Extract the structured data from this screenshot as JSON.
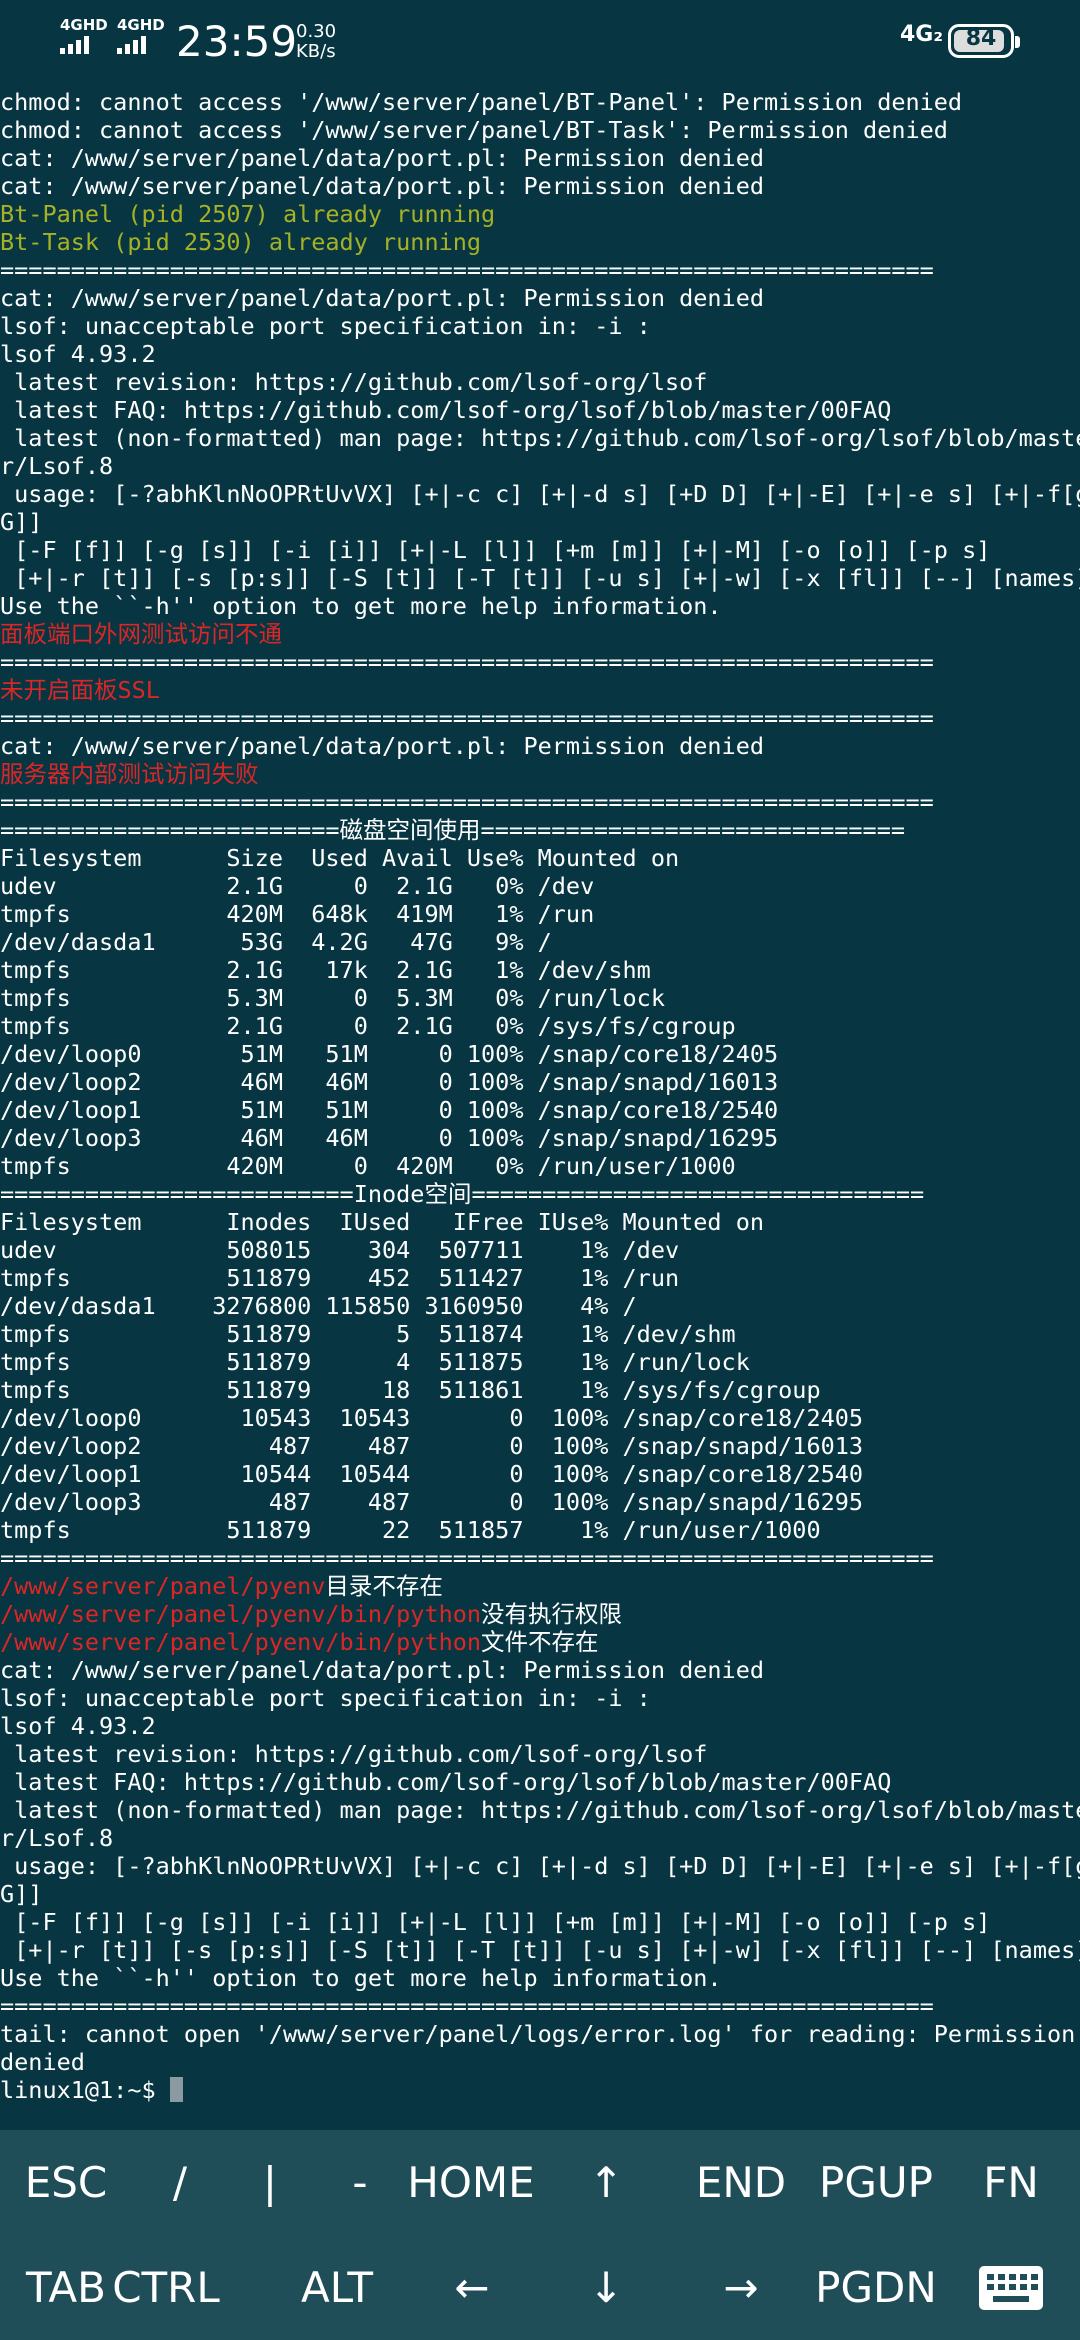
{
  "status_bar": {
    "sim1": "4GHD",
    "sim2": "4GHD",
    "time": "23:59",
    "speed_value": "0.30",
    "speed_unit": "KB/s",
    "network": "4G₂",
    "battery": "84"
  },
  "terminal": {
    "lines": [
      [
        {
          "t": "chmod: cannot access '/www/server/panel/BT-Panel': Permission denied",
          "c": "w"
        }
      ],
      [
        {
          "t": "chmod: cannot access '/www/server/panel/BT-Task': Permission denied",
          "c": "w"
        }
      ],
      [
        {
          "t": "cat: /www/server/panel/data/port.pl: Permission denied",
          "c": "w"
        }
      ],
      [
        {
          "t": "cat: /www/server/panel/data/port.pl: Permission denied",
          "c": "w"
        }
      ],
      [
        {
          "t": "Bt-Panel (pid 2507) already running",
          "c": "g"
        }
      ],
      [
        {
          "t": "Bt-Task (pid 2530) already running",
          "c": "g"
        }
      ],
      [
        {
          "t": "==================================================================",
          "c": "w"
        }
      ],
      [
        {
          "t": "cat: /www/server/panel/data/port.pl: Permission denied",
          "c": "w"
        }
      ],
      [
        {
          "t": "lsof: unacceptable port specification in: -i :",
          "c": "w"
        }
      ],
      [
        {
          "t": "lsof 4.93.2",
          "c": "w"
        }
      ],
      [
        {
          "t": " latest revision: https://github.com/lsof-org/lsof",
          "c": "w"
        }
      ],
      [
        {
          "t": " latest FAQ: https://github.com/lsof-org/lsof/blob/master/00FAQ",
          "c": "w"
        }
      ],
      [
        {
          "t": " latest (non-formatted) man page: https://github.com/lsof-org/lsof/blob/maste",
          "c": "w"
        }
      ],
      [
        {
          "t": "r/Lsof.8",
          "c": "w"
        }
      ],
      [
        {
          "t": " usage: [-?abhKlnNoOPRtUvVX] [+|-c c] [+|-d s] [+D D] [+|-E] [+|-e s] [+|-f[g",
          "c": "w"
        }
      ],
      [
        {
          "t": "G]]",
          "c": "w"
        }
      ],
      [
        {
          "t": " [-F [f]] [-g [s]] [-i [i]] [+|-L [l]] [+m [m]] [+|-M] [-o [o]] [-p s]",
          "c": "w"
        }
      ],
      [
        {
          "t": " [+|-r [t]] [-s [p:s]] [-S [t]] [-T [t]] [-u s] [+|-w] [-x [fl]] [--] [names]",
          "c": "w"
        }
      ],
      [
        {
          "t": "Use the ``-h'' option to get more help information.",
          "c": "w"
        }
      ],
      [
        {
          "t": "面板端口外网测试访问不通",
          "c": "r"
        }
      ],
      [
        {
          "t": "==================================================================",
          "c": "w"
        }
      ],
      [
        {
          "t": "未开启面板SSL",
          "c": "r"
        }
      ],
      [
        {
          "t": "==================================================================",
          "c": "w"
        }
      ],
      [
        {
          "t": "cat: /www/server/panel/data/port.pl: Permission denied",
          "c": "w"
        }
      ],
      [
        {
          "t": "服务器内部测试访问失败",
          "c": "r"
        }
      ],
      [
        {
          "t": "==================================================================",
          "c": "w"
        }
      ],
      [
        {
          "t": "========================磁盘空间使用==============================",
          "c": "w"
        }
      ],
      [
        {
          "t": "Filesystem      Size  Used Avail Use% Mounted on",
          "c": "w"
        }
      ],
      [
        {
          "t": "udev            2.1G     0  2.1G   0% /dev",
          "c": "w"
        }
      ],
      [
        {
          "t": "tmpfs           420M  648k  419M   1% /run",
          "c": "w"
        }
      ],
      [
        {
          "t": "/dev/dasda1      53G  4.2G   47G   9% /",
          "c": "w"
        }
      ],
      [
        {
          "t": "tmpfs           2.1G   17k  2.1G   1% /dev/shm",
          "c": "w"
        }
      ],
      [
        {
          "t": "tmpfs           5.3M     0  5.3M   0% /run/lock",
          "c": "w"
        }
      ],
      [
        {
          "t": "tmpfs           2.1G     0  2.1G   0% /sys/fs/cgroup",
          "c": "w"
        }
      ],
      [
        {
          "t": "/dev/loop0       51M   51M     0 100% /snap/core18/2405",
          "c": "w"
        }
      ],
      [
        {
          "t": "/dev/loop2       46M   46M     0 100% /snap/snapd/16013",
          "c": "w"
        }
      ],
      [
        {
          "t": "/dev/loop1       51M   51M     0 100% /snap/core18/2540",
          "c": "w"
        }
      ],
      [
        {
          "t": "/dev/loop3       46M   46M     0 100% /snap/snapd/16295",
          "c": "w"
        }
      ],
      [
        {
          "t": "tmpfs           420M     0  420M   0% /run/user/1000",
          "c": "w"
        }
      ],
      [
        {
          "t": "=========================Inode空间================================",
          "c": "w"
        }
      ],
      [
        {
          "t": "Filesystem      Inodes  IUsed   IFree IUse% Mounted on",
          "c": "w"
        }
      ],
      [
        {
          "t": "udev            508015    304  507711    1% /dev",
          "c": "w"
        }
      ],
      [
        {
          "t": "tmpfs           511879    452  511427    1% /run",
          "c": "w"
        }
      ],
      [
        {
          "t": "/dev/dasda1    3276800 115850 3160950    4% /",
          "c": "w"
        }
      ],
      [
        {
          "t": "tmpfs           511879      5  511874    1% /dev/shm",
          "c": "w"
        }
      ],
      [
        {
          "t": "tmpfs           511879      4  511875    1% /run/lock",
          "c": "w"
        }
      ],
      [
        {
          "t": "tmpfs           511879     18  511861    1% /sys/fs/cgroup",
          "c": "w"
        }
      ],
      [
        {
          "t": "/dev/loop0       10543  10543       0  100% /snap/core18/2405",
          "c": "w"
        }
      ],
      [
        {
          "t": "/dev/loop2         487    487       0  100% /snap/snapd/16013",
          "c": "w"
        }
      ],
      [
        {
          "t": "/dev/loop1       10544  10544       0  100% /snap/core18/2540",
          "c": "w"
        }
      ],
      [
        {
          "t": "/dev/loop3         487    487       0  100% /snap/snapd/16295",
          "c": "w"
        }
      ],
      [
        {
          "t": "tmpfs           511879     22  511857    1% /run/user/1000",
          "c": "w"
        }
      ],
      [
        {
          "t": "==================================================================",
          "c": "w"
        }
      ],
      [
        {
          "t": "/www/server/panel/pyenv",
          "c": "r"
        },
        {
          "t": "目录不存在",
          "c": "w"
        }
      ],
      [
        {
          "t": "/www/server/panel/pyenv/bin/python",
          "c": "r"
        },
        {
          "t": "没有执行权限",
          "c": "w"
        }
      ],
      [
        {
          "t": "/www/server/panel/pyenv/bin/python",
          "c": "r"
        },
        {
          "t": "文件不存在",
          "c": "w"
        }
      ],
      [
        {
          "t": "cat: /www/server/panel/data/port.pl: Permission denied",
          "c": "w"
        }
      ],
      [
        {
          "t": "lsof: unacceptable port specification in: -i :",
          "c": "w"
        }
      ],
      [
        {
          "t": "lsof 4.93.2",
          "c": "w"
        }
      ],
      [
        {
          "t": " latest revision: https://github.com/lsof-org/lsof",
          "c": "w"
        }
      ],
      [
        {
          "t": " latest FAQ: https://github.com/lsof-org/lsof/blob/master/00FAQ",
          "c": "w"
        }
      ],
      [
        {
          "t": " latest (non-formatted) man page: https://github.com/lsof-org/lsof/blob/maste",
          "c": "w"
        }
      ],
      [
        {
          "t": "r/Lsof.8",
          "c": "w"
        }
      ],
      [
        {
          "t": " usage: [-?abhKlnNoOPRtUvVX] [+|-c c] [+|-d s] [+D D] [+|-E] [+|-e s] [+|-f[g",
          "c": "w"
        }
      ],
      [
        {
          "t": "G]]",
          "c": "w"
        }
      ],
      [
        {
          "t": " [-F [f]] [-g [s]] [-i [i]] [+|-L [l]] [+m [m]] [+|-M] [-o [o]] [-p s]",
          "c": "w"
        }
      ],
      [
        {
          "t": " [+|-r [t]] [-s [p:s]] [-S [t]] [-T [t]] [-u s] [+|-w] [-x [fl]] [--] [names]",
          "c": "w"
        }
      ],
      [
        {
          "t": "Use the ``-h'' option to get more help information.",
          "c": "w"
        }
      ],
      [
        {
          "t": "==================================================================",
          "c": "w"
        }
      ],
      [
        {
          "t": "tail: cannot open '/www/server/panel/logs/error.log' for reading: Permission",
          "c": "w"
        }
      ],
      [
        {
          "t": "denied",
          "c": "w"
        }
      ]
    ],
    "prompt": "linux1@1:~$ "
  },
  "extra_keys": {
    "row1": [
      "ESC",
      "/",
      "|",
      "-",
      "HOME",
      "↑",
      "END",
      "PGUP",
      "FN"
    ],
    "row2": [
      "TAB",
      "CTRL",
      "ALT",
      "←",
      "↓",
      "→",
      "PGDN",
      "keyboard-icon"
    ]
  },
  "colors": {
    "background": "#073642",
    "text": "#ffffff",
    "green": "#a6b225",
    "red": "#dc2626",
    "keys_background": "#1f4d58"
  }
}
